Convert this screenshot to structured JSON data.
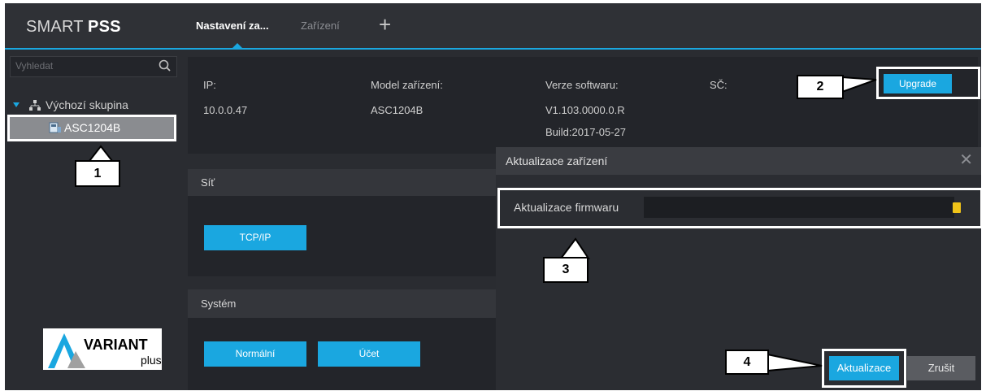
{
  "app": {
    "name_light": "SMART ",
    "name_bold": "PSS"
  },
  "tabs": [
    {
      "label": "Nastavení za..."
    },
    {
      "label": "Zařízení"
    }
  ],
  "sidebar": {
    "search_placeholder": "Vyhledat",
    "group_label": "Výchozí skupina",
    "device_label": "ASC1204B"
  },
  "device_info": {
    "ip_label": "IP:",
    "ip_value": "10.0.0.47",
    "model_label": "Model zařízení:",
    "model_value": "ASC1204B",
    "sw_label": "Verze softwaru:",
    "sw_value": "V1.103.0000.0.R",
    "build_value": "Build:2017-05-27",
    "sn_label": "SČ:",
    "upgrade_label": "Upgrade"
  },
  "sections": {
    "network_title": "Síť",
    "tcpip_label": "TCP/IP",
    "system_title": "Systém",
    "normal_label": "Normální",
    "account_label": "Účet"
  },
  "dialog": {
    "title": "Aktualizace zařízení",
    "close_glyph": "✕",
    "firmware_label": "Aktualizace firmwaru",
    "update_label": "Aktualizace",
    "cancel_label": "Zrušit"
  },
  "callouts": [
    "1",
    "2",
    "3",
    "4"
  ],
  "logo": {
    "line1": "VARIANT",
    "line2": "plus"
  },
  "colors": {
    "accent": "#1aa7e0",
    "background": "#2a2c31",
    "panel": "#23252a"
  }
}
